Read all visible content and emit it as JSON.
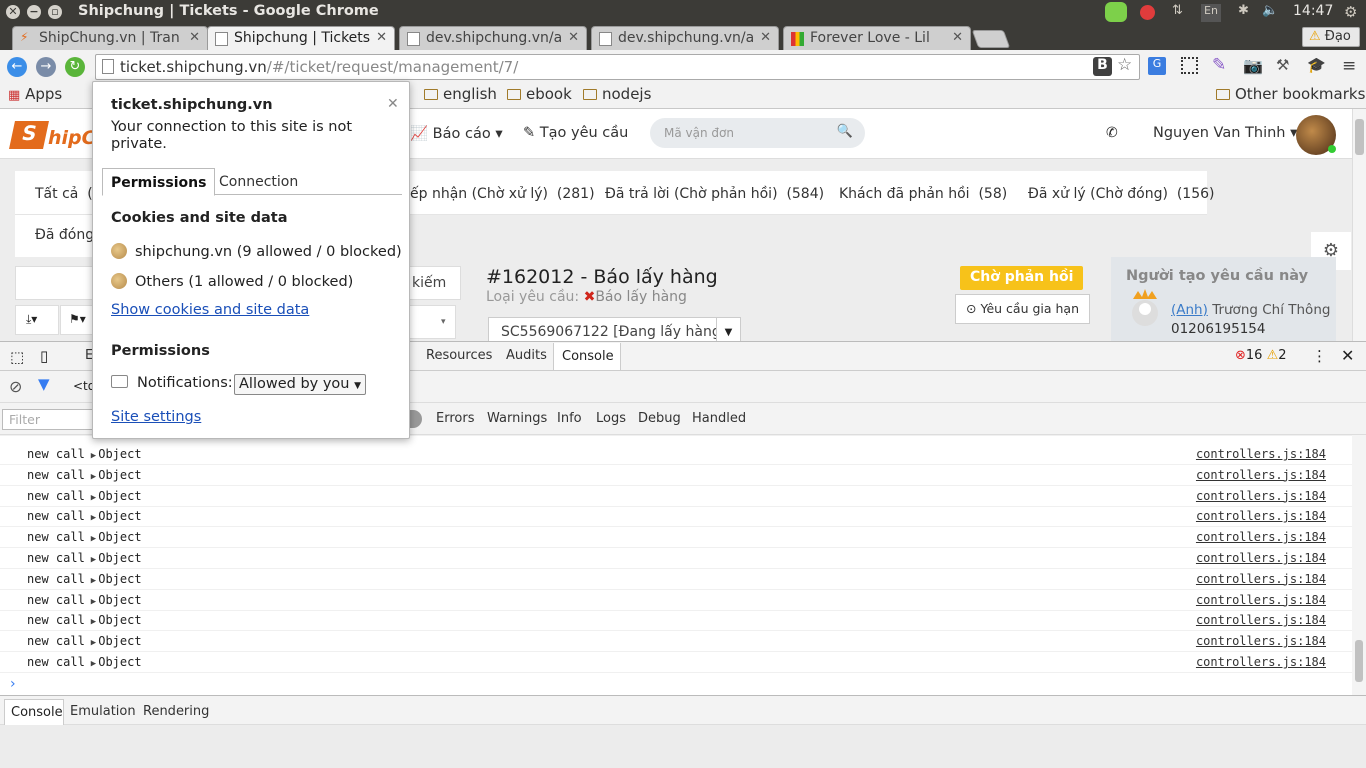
{
  "window": {
    "title": "Shipchung | Tickets - Google Chrome",
    "clock": "14:47",
    "user": "Đạo",
    "lang_indicator": "En"
  },
  "tabs": [
    {
      "label": "ShipChung.vn | Tran",
      "active": false
    },
    {
      "label": "Shipchung | Tickets",
      "active": true
    },
    {
      "label": "dev.shipchung.vn/a",
      "active": false
    },
    {
      "label": "dev.shipchung.vn/a",
      "active": false
    },
    {
      "label": "Forever Love - Lil ",
      "active": false
    }
  ],
  "omnibox": {
    "host": "ticket.shipchung.vn",
    "path": "/#/ticket/request/management/7/"
  },
  "bookmarks": {
    "apps": "Apps",
    "items": [
      "english",
      "ebook",
      "nodejs"
    ],
    "other": "Other bookmarks"
  },
  "app": {
    "logo_text": "hipC",
    "nav_report": "Báo cáo",
    "nav_create": "Tạo yêu cầu",
    "search_placeholder": "Mã vận đơn",
    "user_name": "Nguyen Van Thinh",
    "status_tabs": [
      {
        "label": "Tất cả",
        "count": "(4"
      },
      {
        "label": "ếp nhận (Chờ xử lý)",
        "count": "(281)"
      },
      {
        "label": "Đã trả lời (Chờ phản hồi)",
        "count": "(584)"
      },
      {
        "label": "Khách đã phản hồi",
        "count": "(58)"
      },
      {
        "label": "Đã xử lý (Chờ đóng)",
        "count": "(156)"
      }
    ],
    "closed_tab": "Đã đóng",
    "search_button_tail": "kiếm",
    "ticket": {
      "title": "#162012 - Báo lấy hàng",
      "type_label": "Loại yêu cầu:",
      "type_value": "Báo lấy hàng",
      "status_badge": "Chờ phản hồi",
      "extend_button": "Yêu cầu gia hạn",
      "order_ref": "SC5569067122 [Đang lấy hàng]"
    },
    "creator": {
      "heading": "Người tạo yêu cầu này",
      "honorific": "(Anh)",
      "name": "Trương Chí Thông",
      "phone": "01206195154"
    }
  },
  "site_info": {
    "host": "ticket.shipchung.vn",
    "warning": "Your connection to this site is not private.",
    "tab_permissions": "Permissions",
    "tab_connection": "Connection",
    "cookies_heading": "Cookies and site data",
    "cookie_rows": [
      "shipchung.vn (9 allowed / 0 blocked)",
      "Others (1 allowed / 0 blocked)"
    ],
    "show_cookies_link": "Show cookies and site data",
    "permissions_heading": "Permissions",
    "notifications_label": "Notifications:",
    "notifications_value": "Allowed by you",
    "site_settings_link": "Site settings"
  },
  "devtools": {
    "tabs": [
      "E",
      "Resources",
      "Audits",
      "Console"
    ],
    "error_count": "16",
    "warning_count": "2",
    "context_fragment": "<to",
    "filter_placeholder": "Filter",
    "levels": [
      "Errors",
      "Warnings",
      "Info",
      "Logs",
      "Debug",
      "Handled"
    ],
    "console_rows": [
      {
        "text": "new call",
        "obj": "Object",
        "src": "controllers.js:184"
      },
      {
        "text": "new call",
        "obj": "Object",
        "src": "controllers.js:184"
      },
      {
        "text": "new call",
        "obj": "Object",
        "src": "controllers.js:184"
      },
      {
        "text": "new call",
        "obj": "Object",
        "src": "controllers.js:184"
      },
      {
        "text": "new call",
        "obj": "Object",
        "src": "controllers.js:184"
      },
      {
        "text": "new call",
        "obj": "Object",
        "src": "controllers.js:184"
      },
      {
        "text": "new call",
        "obj": "Object",
        "src": "controllers.js:184"
      },
      {
        "text": "new call",
        "obj": "Object",
        "src": "controllers.js:184"
      },
      {
        "text": "new call",
        "obj": "Object",
        "src": "controllers.js:184"
      },
      {
        "text": "new call",
        "obj": "Object",
        "src": "controllers.js:184"
      },
      {
        "text": "new call",
        "obj": "Object",
        "src": "controllers.js:184"
      }
    ],
    "drawer_tabs": [
      "Console",
      "Emulation",
      "Rendering"
    ]
  }
}
